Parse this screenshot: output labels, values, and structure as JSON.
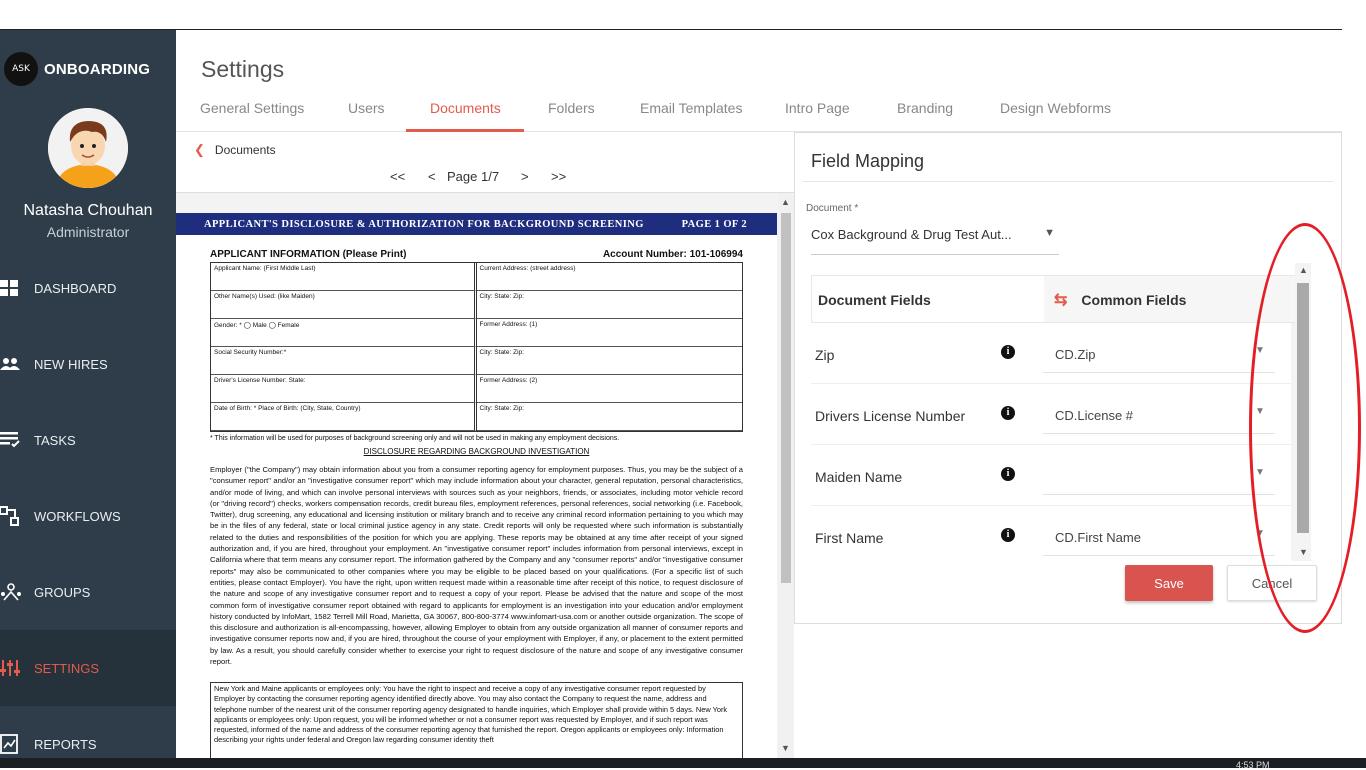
{
  "app": {
    "brand": "ONBOARDING",
    "logo_text": "ASK"
  },
  "user": {
    "name": "Natasha Chouhan",
    "role": "Administrator"
  },
  "nav": [
    {
      "label": "DASHBOARD",
      "icon": "dashboard-icon"
    },
    {
      "label": "NEW HIRES",
      "icon": "new-hires-icon"
    },
    {
      "label": "TASKS",
      "icon": "tasks-icon"
    },
    {
      "label": "WORKFLOWS",
      "icon": "workflows-icon"
    },
    {
      "label": "GROUPS",
      "icon": "groups-icon"
    },
    {
      "label": "SETTINGS",
      "icon": "settings-icon",
      "active": true
    },
    {
      "label": "REPORTS",
      "icon": "reports-icon"
    }
  ],
  "page": {
    "title": "Settings"
  },
  "tabs": [
    {
      "label": "General Settings"
    },
    {
      "label": "Users"
    },
    {
      "label": "Documents",
      "active": true
    },
    {
      "label": "Folders"
    },
    {
      "label": "Email Templates"
    },
    {
      "label": "Intro Page"
    },
    {
      "label": "Branding"
    },
    {
      "label": "Design Webforms"
    }
  ],
  "breadcrumb": {
    "label": "Documents"
  },
  "pager": {
    "first": "<<",
    "prev": "<",
    "page_text": "Page 1/7",
    "next": ">",
    "last": ">>"
  },
  "document_preview": {
    "banner_title": "Applicant's Disclosure & Authorization for Background Screening",
    "banner_page": "Page 1 of 2",
    "section_title": "APPLICANT INFORMATION (Please Print)",
    "account_label": "Account Number:  101-106994",
    "form_cells": [
      "Applicant Name: (First  Middle  Last)",
      "Current Address: (street address)",
      "Other Name(s) Used: (like Maiden)",
      "City:                    State:          Zip:",
      "Gender: *   ◯ Male   ◯ Female",
      "Former Address: (1)",
      "Social Security Number:*",
      "City:                    State:          Zip:",
      "Driver's License Number:            State:",
      "Former Address: (2)",
      "Date of Birth: *        Place of Birth: (City, State, Country)",
      "City:                    State:          Zip:"
    ],
    "note": "* This information will be used for purposes of background screening only and will not be used in making any employment decisions.",
    "subheading": "DISCLOSURE REGARDING BACKGROUND INVESTIGATION",
    "paragraph": "Employer (\"the Company\") may obtain information about you from a consumer reporting agency for employment purposes. Thus, you may be the subject of a \"consumer report\" and/or an \"investigative consumer report\" which may include information about your character, general reputation, personal characteristics, and/or mode of living, and which can involve personal interviews with sources such as your neighbors, friends, or associates, including motor vehicle record (or \"driving record\") checks, workers compensation records, credit bureau files, employment references, personal references, social networking (i.e. Facebook, Twitter), drug screening, any educational and licensing institution or military branch and to receive any criminal record information pertaining to you which may be in the files of any federal, state or local criminal justice agency in any state. Credit reports will only be requested where such information is substantially related to the duties and responsibilities of the position for which you are applying. These reports may be obtained at any time after receipt of your signed authorization and, if you are hired, throughout your employment. An \"investigative consumer report\" includes information from personal interviews, except in California where that term means any consumer report. The information gathered by the Company and any \"consumer reports\" and/or \"investigative consumer reports\" may also be communicated to other companies where you may be eligible to be placed based on your qualifications. (For a specific list of such entities, please contact Employer). You have the right, upon written request made within a reasonable time after receipt of this notice, to request disclosure of the nature and scope of any investigative consumer report and to request a copy of your report. Please be advised that the nature and scope of the most common form of investigative consumer report obtained with regard to applicants for employment is an investigation into your education and/or employment history conducted by InfoMart, 1582 Terrell Mill Road, Marietta, GA 30067, 800-800-3774 www.infomart-usa.com or another outside organization. The scope of this disclosure and authorization is all-encompassing, however, allowing Employer to obtain from any outside organization all manner of consumer reports and investigative consumer reports now and, if you are hired, throughout the course of your employment with Employer, if any, or placement to the extent permitted by law. As a result, you should carefully consider whether to exercise your right to request disclosure of the nature and scope of any investigative consumer report.",
    "box_text": "New York and Maine applicants or employees only: You have the right to inspect and receive a copy of any investigative consumer report requested by Employer by contacting the consumer reporting agency identified directly above. You may also contact the Company to request the name, address and telephone number of the nearest unit of the consumer reporting agency designated to handle inquiries, which Employer shall provide within 5 days. New York applicants or employees only: Upon request, you will be informed whether or not a consumer report was requested by Employer, and if such report was requested, informed of the name and address of the consumer reporting agency that furnished the report. Oregon applicants or employees only: Information describing your rights under federal and Oregon law regarding consumer identity theft"
  },
  "field_mapping": {
    "title": "Field Mapping",
    "document_label": "Document *",
    "document_value": "Cox Background & Drug Test Aut...",
    "col_document_fields": "Document Fields",
    "col_common_fields": "Common Fields",
    "rows": [
      {
        "field": "Zip",
        "common": "CD.Zip"
      },
      {
        "field": "Drivers License Number",
        "common": "CD.License #"
      },
      {
        "field": "Maiden Name",
        "common": ""
      },
      {
        "field": "First Name",
        "common": "CD.First Name"
      }
    ],
    "save_label": "Save",
    "cancel_label": "Cancel"
  },
  "taskbar": {
    "clock": "4:53 PM"
  },
  "colors": {
    "accent": "#e25b4b",
    "sidebar": "#2f3d4a",
    "save_button": "#d9534f",
    "annotation": "#e41e26",
    "doc_banner": "#1f2d7f"
  }
}
